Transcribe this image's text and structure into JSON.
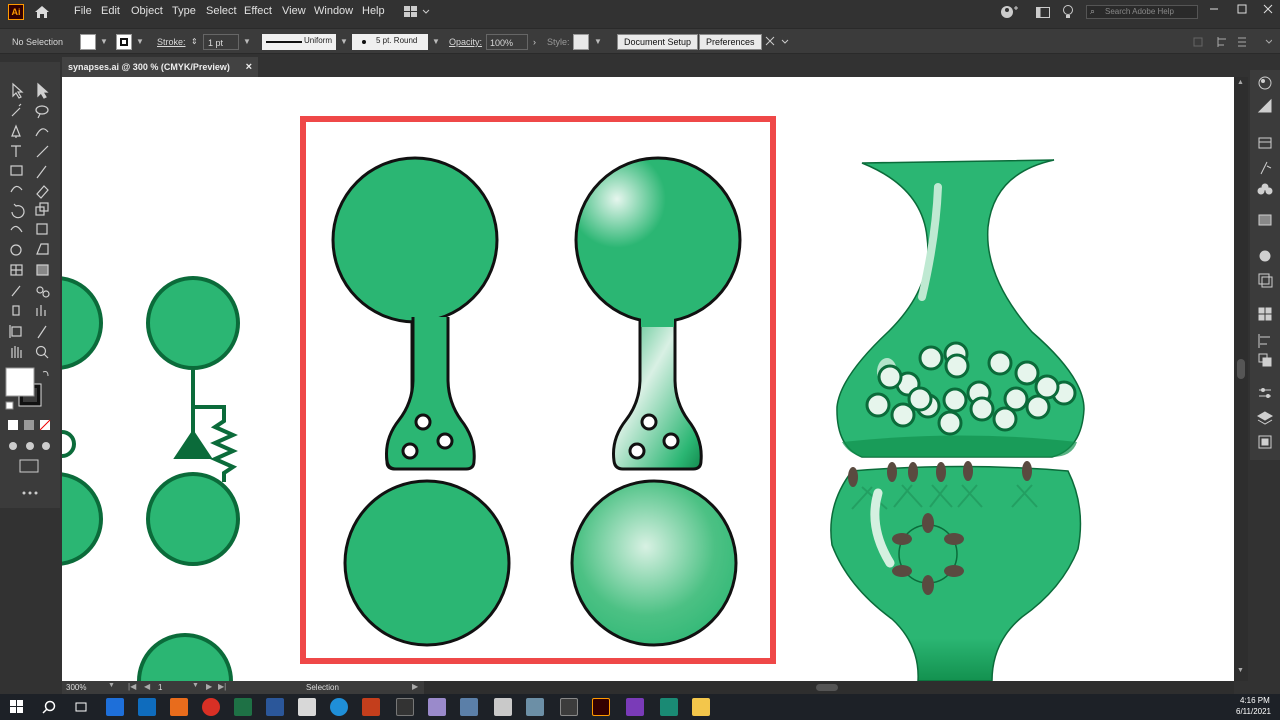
{
  "app": {
    "logo_text": "Ai",
    "menu": [
      "File",
      "Edit",
      "Object",
      "Type",
      "Select",
      "Effect",
      "View",
      "Window",
      "Help"
    ],
    "search_placeholder": "Search Adobe Help"
  },
  "control_bar": {
    "selection_label": "No Selection",
    "stroke_label": "Stroke:",
    "stroke_value": "1 pt",
    "profile_value": "Uniform",
    "brush_value": "5 pt. Round",
    "opacity_label": "Opacity:",
    "opacity_value": "100%",
    "style_label": "Style:",
    "document_setup_label": "Document Setup",
    "preferences_label": "Preferences"
  },
  "document": {
    "tab_title": "synapses.ai @ 300 % (CMYK/Preview)",
    "close_glyph": "×"
  },
  "status": {
    "zoom": "300%",
    "artboard": "1",
    "tool": "Selection"
  },
  "taskbar": {
    "time": "4:16 PM",
    "date": "6/11/2021"
  },
  "colors": {
    "synapse_green": "#2bb673",
    "outline": "#111111",
    "highlight_frame": "#ef4848",
    "dark_green": "#0b6b3a"
  }
}
